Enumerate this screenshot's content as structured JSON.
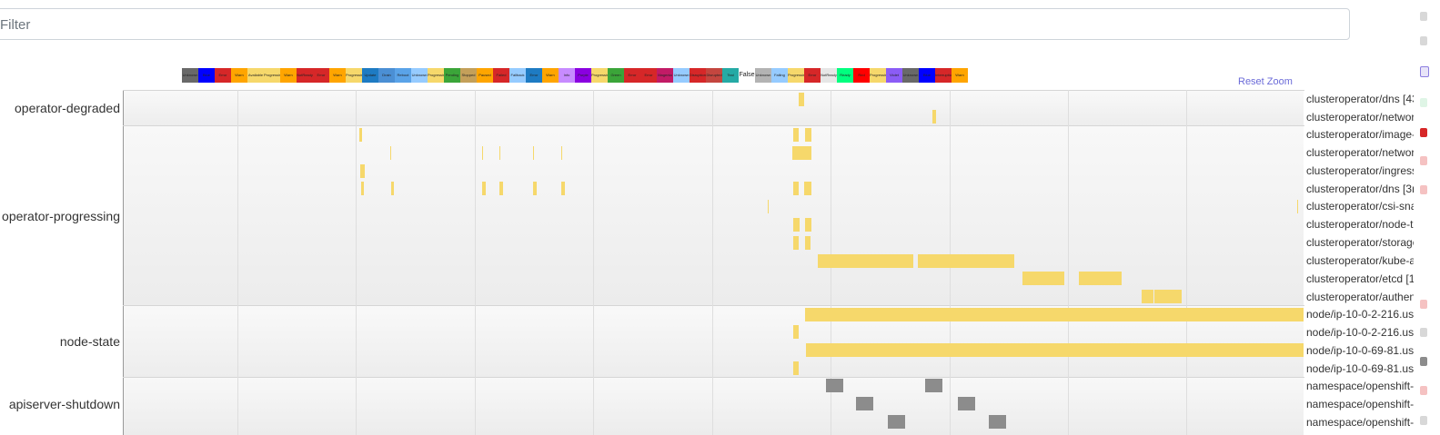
{
  "filter": {
    "placeholder": "Filter",
    "value": ""
  },
  "reset_zoom": "Reset Zoom",
  "legend": [
    {
      "label": "Unknown",
      "color": "#696969"
    },
    {
      "label": "Blue",
      "color": "#0000ff"
    },
    {
      "label": "Error",
      "color": "#d62728"
    },
    {
      "label": "Warn",
      "color": "#ffa500"
    },
    {
      "label": "Available",
      "color": "#f6d86b"
    },
    {
      "label": "Progressing",
      "color": "#f6d86b"
    },
    {
      "label": "Warn",
      "color": "#ffa500"
    },
    {
      "label": "NotReady",
      "color": "#d62728"
    },
    {
      "label": "Error",
      "color": "#d62728"
    },
    {
      "label": "Warn",
      "color": "#ffa500"
    },
    {
      "label": "Progressing",
      "color": "#f6d86b"
    },
    {
      "label": "Update",
      "color": "#1e7bc3"
    },
    {
      "label": "Drain",
      "color": "#4b8fd4"
    },
    {
      "label": "Reboot",
      "color": "#5aa3e8"
    },
    {
      "label": "Unknown",
      "color": "#96cbff"
    },
    {
      "label": "Progressing",
      "color": "#f6d86b"
    },
    {
      "label": "Pending",
      "color": "#3ba539"
    },
    {
      "label": "Stopped",
      "color": "#c4a05a"
    },
    {
      "label": "Paused",
      "color": "#ffa500"
    },
    {
      "label": "Failed",
      "color": "#d62728"
    },
    {
      "label": "Fallback",
      "color": "#96cbff"
    },
    {
      "label": "Error",
      "color": "#1e7bc3"
    },
    {
      "label": "Warn",
      "color": "#ffa500"
    },
    {
      "label": "Info",
      "color": "#c78bff"
    },
    {
      "label": "Purple",
      "color": "#8a00e0"
    },
    {
      "label": "Progressing",
      "color": "#f6d86b"
    },
    {
      "label": "Green",
      "color": "#3ba539"
    },
    {
      "label": "Error",
      "color": "#d62728"
    },
    {
      "label": "Error",
      "color": "#d62728"
    },
    {
      "label": "Magenta",
      "color": "#c21b66"
    },
    {
      "label": "Unknown",
      "color": "#96cbff"
    },
    {
      "label": "Disruption",
      "color": "#d62728"
    },
    {
      "label": "Disrupted",
      "color": "#c4463f"
    },
    {
      "label": "Teal",
      "color": "#25aaa5"
    },
    {
      "label": "False",
      "color": "#ffffff"
    },
    {
      "label": "Unknown",
      "color": "#b3b3b3"
    },
    {
      "label": "Failing",
      "color": "#96cbff"
    },
    {
      "label": "Progressing",
      "color": "#f6d86b"
    },
    {
      "label": "Error",
      "color": "#d62728"
    },
    {
      "label": "NotReady",
      "color": "#e6e6e6"
    },
    {
      "label": "Ready",
      "color": "#00ff7f"
    },
    {
      "label": "Red",
      "color": "#ff0000"
    },
    {
      "label": "Progressing",
      "color": "#f6d86b"
    },
    {
      "label": "Violet",
      "color": "#8b5cf6"
    },
    {
      "label": "Unknown",
      "color": "#696969"
    },
    {
      "label": "Blue",
      "color": "#0000ff"
    },
    {
      "label": "Interruption",
      "color": "#d62728"
    },
    {
      "label": "Warn",
      "color": "#ffa500"
    }
  ],
  "groups": [
    {
      "label": "operator-degraded"
    },
    {
      "label": "operator-progressing"
    },
    {
      "label": "node-state"
    },
    {
      "label": "apiserver-shutdown"
    }
  ],
  "rows": [
    {
      "label": "clusteroperator/dns [43"
    },
    {
      "label": "clusteroperator/network"
    },
    {
      "label": "clusteroperator/image-registry"
    },
    {
      "label": "clusteroperator/network"
    },
    {
      "label": "clusteroperator/ingress"
    },
    {
      "label": "clusteroperator/dns [3m"
    },
    {
      "label": "clusteroperator/csi-snapshot-controller"
    },
    {
      "label": "clusteroperator/node-tuning"
    },
    {
      "label": "clusteroperator/storage"
    },
    {
      "label": "clusteroperator/kube-apiserver"
    },
    {
      "label": "clusteroperator/etcd [1"
    },
    {
      "label": "clusteroperator/authentication"
    },
    {
      "label": "node/ip-10-0-2-216.us"
    },
    {
      "label": "node/ip-10-0-2-216.us"
    },
    {
      "label": "node/ip-10-0-69-81.us"
    },
    {
      "label": "node/ip-10-0-69-81.us"
    },
    {
      "label": "namespace/openshift-"
    },
    {
      "label": "namespace/openshift-"
    },
    {
      "label": "namespace/openshift-"
    }
  ],
  "colors": {
    "progressing": "#f6d86b",
    "shutdown": "#8c8c8c",
    "accent_link": "#6a6ad8"
  }
}
